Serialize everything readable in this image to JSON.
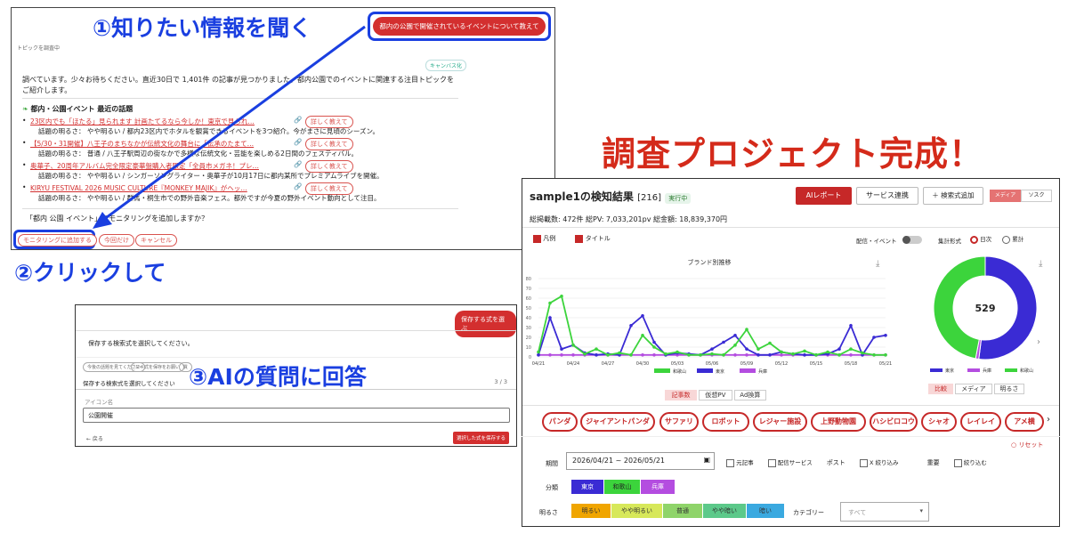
{
  "colors": {
    "annotation_blue": "#1a3fe0",
    "accent_red": "#c62828",
    "purple": "#3a2bd4",
    "green": "#3cd43c",
    "violet": "#b44de0"
  },
  "annotations": {
    "step1": "①知りたい情報を聞く",
    "step2": "②クリックして",
    "step3": "③AIの質問に回答",
    "headline": "調査プロジェクト完成！"
  },
  "chat": {
    "user_query": "都内の公園で開催されているイベントについて教えて",
    "topic_badge": "トピックを調査中",
    "canvas_badge": "キャンバス化",
    "intro": "調べています。少々お待ちください。直近30日で 1,401件 の記事が見つかりました。都内公園でのイベントに関連する注目トピックをご紹介します。",
    "section_title": "都内・公園イベント 最近の話題",
    "topics": [
      {
        "title": "23区内でも「ほたる」見られます 計画たてるなら今しか！東京で見られ…",
        "detail": "話題の明るさ： やや明るい / 都内23区内でホタルを観賞できるイベントを3つ紹介。今がまさに見頃のシーズン。"
      },
      {
        "title": "【5/30・31開催】八王子のまちなかが伝統文化の舞台に「伝承のたまて…",
        "detail": "話題の明るさ： 普通 / 八王子駅周辺の街なかで多様な伝統文化・芸能を楽しめる2日間のフェスティバル。"
      },
      {
        "title": "奥華子、20周年アルバム完全限定豪華盤購入者限定「全員市メガネ！プレ…",
        "detail": "話題の明るさ： やや明るい / シンガーソングライター・奥華子が10月17日に都内某所でプレミアムライブを開催。"
      },
      {
        "title": "KIRYU FESTIVAL 2026 MUSIC CULTURE『MONKEY MAJIK』がヘッ…",
        "detail": "話題の明るさ： やや明るい / 群馬・桐生市での野外音楽フェス。都外ですが今夏の野外イベント動向として注目。"
      }
    ],
    "detail_button": "詳しく教えて",
    "prompt": "「都内 公園 イベント」をモニタリングを追加しますか？",
    "buttons": [
      "モニタリングに追加する",
      "今回だけ",
      "キャンセル"
    ]
  },
  "dialog": {
    "save_button": "保存する式を選ぶ",
    "prompt": "保存する検索式を選択してください。",
    "chips": [
      "今後の話題を見てください",
      "スキ式を保存をお願い",
      "質"
    ],
    "question": "保存する検索式を選択してください",
    "page": "3 / 3",
    "field_label": "アイコン名",
    "field_value": "公園開催",
    "back": "← 戻る",
    "confirm": "選択した式を保存する"
  },
  "dashboard": {
    "title": "sample1の検知結果",
    "count": "[216]",
    "status": "実行中",
    "buttons": [
      "AIレポート",
      "サービス連携",
      "＋ 検索式追加"
    ],
    "toggle": [
      "メディア",
      "ソスク"
    ],
    "stats": "総掲載数: 472件 総PV: 7,033,201pv 総金額: 18,839,370円",
    "options": {
      "legend": "凡例",
      "title": "タイトル",
      "delivery": "配信・イベント",
      "aggregate": "集計形式",
      "daily": "日次",
      "cumulative": "累計"
    },
    "line_footer_tabs": [
      "記事数",
      "仮想PV",
      "Ad換算"
    ],
    "donut_footer_tabs": [
      "比較",
      "メディア",
      "明るさ"
    ],
    "tags": [
      "パンダ",
      "ジャイアントパンダ",
      "サファリ",
      "ロボット",
      "レジャー施設",
      "上野動物園",
      "ハシビロコウ",
      "シャオ",
      "レイレイ",
      "アメ横"
    ],
    "reset": "リセット",
    "filters": {
      "period_label": "期間",
      "period_value": "2026/04/21 ~ 2026/05/21",
      "checks": [
        "元記事",
        "配信サービス"
      ],
      "post": "ポスト",
      "narrow": "X 絞り込み",
      "important": "重要",
      "narrow2": "絞り込む",
      "class_label": "分類",
      "classes": [
        "東京",
        "和歌山",
        "兵庫"
      ],
      "bright_label": "明るさ",
      "brights": [
        "明るい",
        "やや明るい",
        "普通",
        "やや暗い",
        "暗い"
      ],
      "category_label": "カテゴリー",
      "category_placeholder": "すべて"
    }
  },
  "chart_data": [
    {
      "type": "line",
      "title": "ブランド別推移",
      "categories": [
        "04/21",
        "04/24",
        "04/27",
        "04/30",
        "05/03",
        "05/06",
        "05/09",
        "05/12",
        "05/15",
        "05/18",
        "05/21"
      ],
      "ylim": [
        0,
        80
      ],
      "yticks": [
        0,
        10,
        20,
        30,
        40,
        50,
        60,
        70,
        80
      ],
      "series": [
        {
          "name": "和歌山",
          "color": "#3cd43c",
          "values": [
            5,
            55,
            62,
            12,
            3,
            8,
            2,
            4,
            2,
            22,
            10,
            3,
            5,
            2,
            2,
            3,
            2,
            12,
            28,
            8,
            14,
            5,
            3,
            6,
            2,
            5,
            2,
            8,
            4,
            2,
            2
          ]
        },
        {
          "name": "東京",
          "color": "#3a2bd4",
          "values": [
            2,
            40,
            8,
            12,
            4,
            2,
            3,
            2,
            32,
            42,
            15,
            2,
            4,
            3,
            2,
            8,
            15,
            22,
            8,
            2,
            2,
            5,
            3,
            2,
            2,
            3,
            8,
            32,
            2,
            20,
            22
          ]
        },
        {
          "name": "兵庫",
          "color": "#b44de0",
          "values": [
            2,
            2,
            2,
            2,
            2,
            2,
            2,
            2,
            2,
            2,
            2,
            2,
            2,
            2,
            2,
            2,
            2,
            2,
            2,
            2,
            2,
            2,
            2,
            2,
            2,
            2,
            2,
            2,
            2,
            2,
            2
          ]
        }
      ]
    },
    {
      "type": "pie",
      "center_label": "529",
      "series": [
        {
          "name": "東京",
          "value": 52,
          "color": "#3a2bd4"
        },
        {
          "name": "兵庫",
          "value": 1,
          "color": "#b44de0"
        },
        {
          "name": "和歌山",
          "value": 47,
          "color": "#3cd43c"
        }
      ]
    }
  ]
}
